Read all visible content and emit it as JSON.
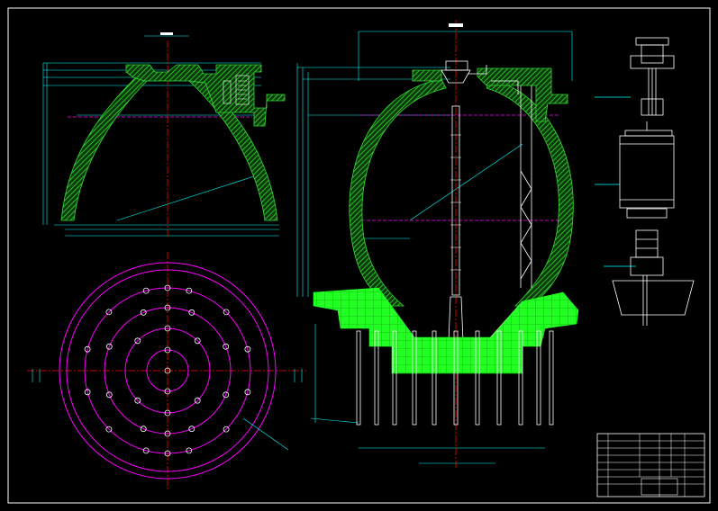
{
  "colors": {
    "background": "#000000",
    "frame": "#ffffff",
    "dimension": "#00ffff",
    "centerline": "#ff0000",
    "hatch": "#00cc00",
    "concrete_fill": "#00ff00",
    "circle": "#ff00ff",
    "bolt_hole": "#ffffff",
    "equipment": "#ffffff"
  },
  "icons": [
    "digester-section-icon",
    "digester-plan-icon",
    "mixer-equipment-icon",
    "title-block"
  ]
}
